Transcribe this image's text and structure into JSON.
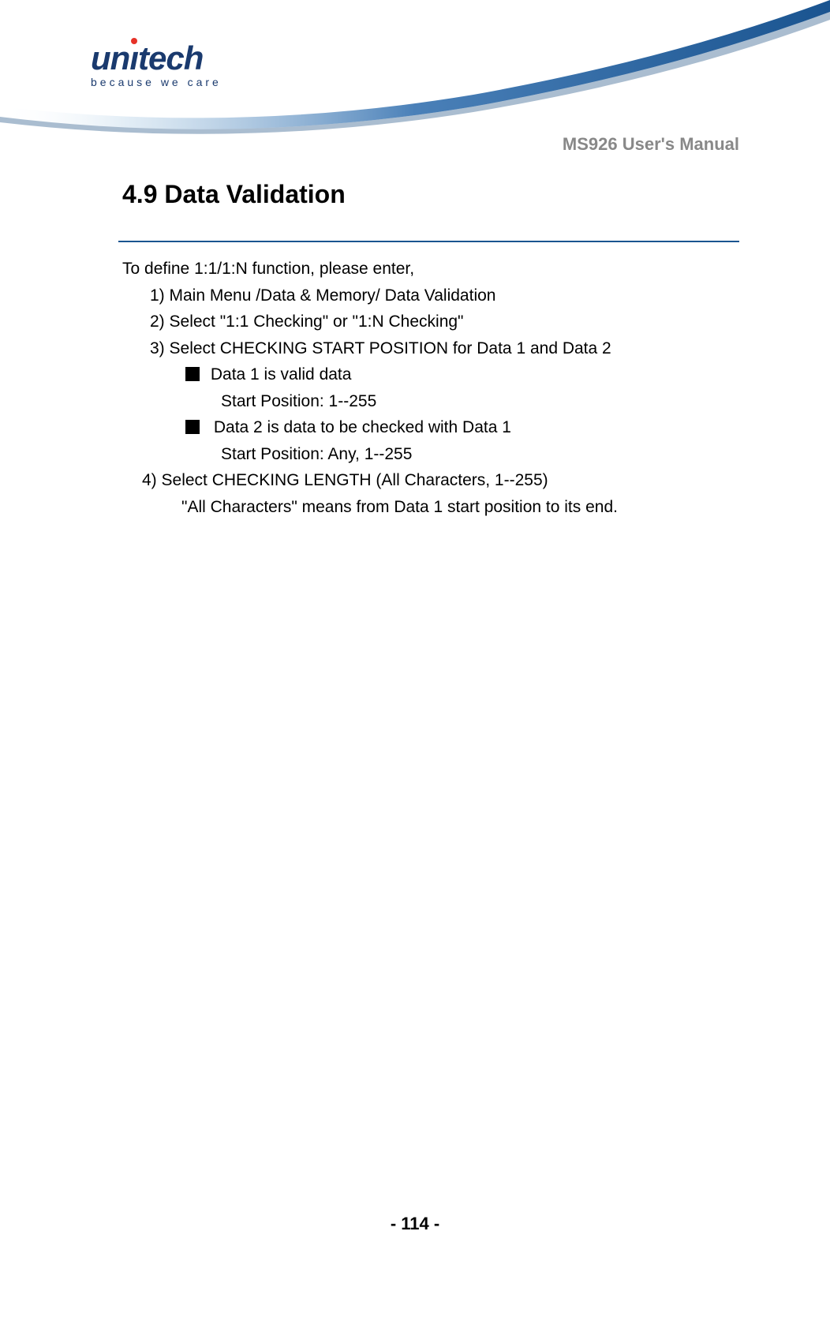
{
  "header": {
    "logo_text": "unitech",
    "logo_tagline": "because we care",
    "manual_title": "MS926 User's Manual"
  },
  "section": {
    "title": "4.9 Data Validation"
  },
  "body": {
    "intro": "To define 1:1/1:N function, please enter,",
    "step1": "1) Main Menu /Data & Memory/ Data Validation",
    "step2": "2) Select \"1:1 Checking\" or \"1:N Checking\"",
    "step3": "3) Select CHECKING START POSITION for Data 1 and Data 2",
    "bullet1": "Data 1 is valid data",
    "bullet1_detail": "Start Position:   1--255",
    "bullet2": "Data 2 is data to be checked with Data 1",
    "bullet2_detail": "Start Position:    Any, 1--255",
    "step4": "4) Select CHECKING LENGTH   (All Characters, 1--255)",
    "step4_detail": "\"All Characters\" means from Data 1 start position to its end."
  },
  "footer": {
    "page_number": "- 114 -"
  }
}
